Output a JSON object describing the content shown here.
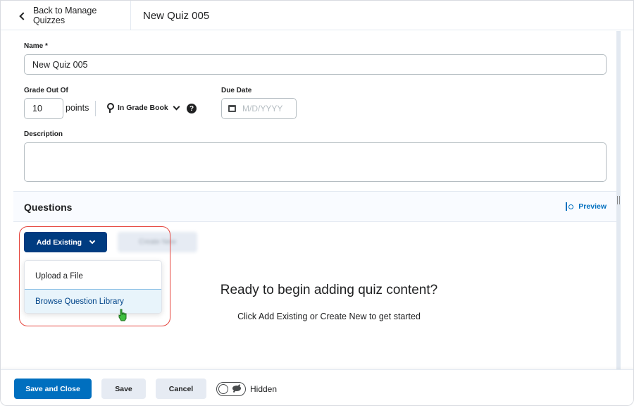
{
  "topbar": {
    "back_label": "Back to Manage Quizzes",
    "title": "New Quiz 005"
  },
  "form": {
    "name_label": "Name *",
    "name_value": "New Quiz 005",
    "grade_label": "Grade Out Of",
    "grade_value": "10",
    "points_label": "points",
    "gradebook_label": "In Grade Book",
    "help_glyph": "?",
    "due_label": "Due Date",
    "due_placeholder": "M/D/YYYY",
    "description_label": "Description",
    "description_value": ""
  },
  "questions": {
    "title": "Questions",
    "preview_label": "Preview",
    "add_existing_label": "Add Existing",
    "create_new_label": "Create New",
    "menu_items": [
      {
        "label": "Upload a File",
        "selected": false
      },
      {
        "label": "Browse Question Library",
        "selected": true
      }
    ],
    "empty_title": "Ready to begin adding quiz content?",
    "empty_subtitle": "Click Add Existing or Create New to get started"
  },
  "footer": {
    "save_close_label": "Save and Close",
    "save_label": "Save",
    "cancel_label": "Cancel",
    "visibility_label": "Hidden",
    "visibility_on": false
  },
  "colors": {
    "primary": "#006fbf",
    "dark_primary": "#003b80",
    "highlight_ring": "#e5453d",
    "menu_selected_bg": "#e8f4fb"
  }
}
